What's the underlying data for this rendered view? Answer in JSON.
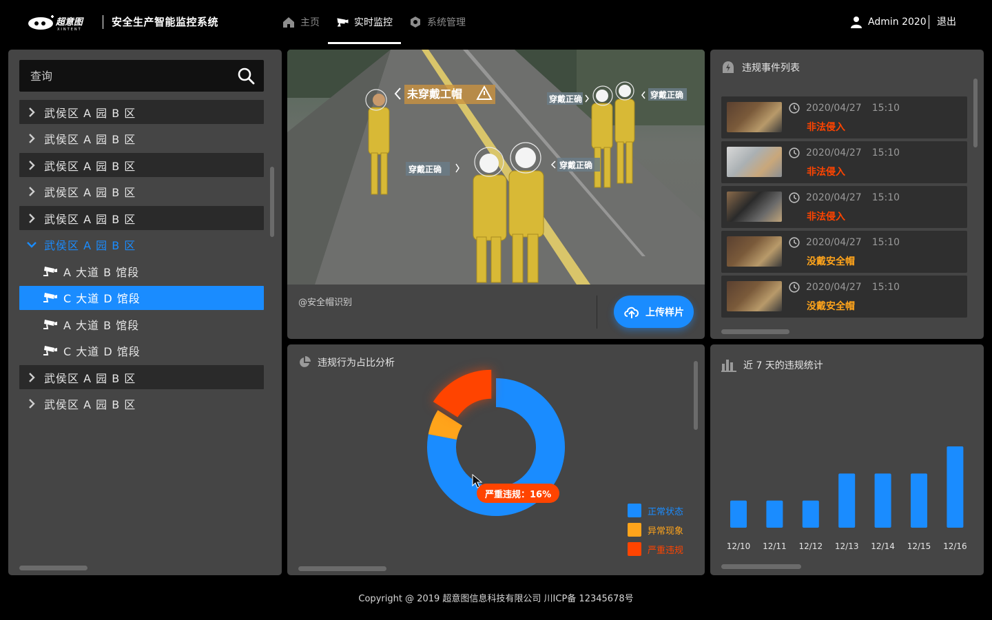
{
  "header": {
    "logo_text": "超意图",
    "logo_subtext": "XINTENT",
    "app_title": "安全生产智能监控系统",
    "nav": [
      {
        "label": "主页",
        "icon": "home-icon",
        "active": false
      },
      {
        "label": "实时监控",
        "icon": "camera-icon",
        "active": true
      },
      {
        "label": "系统管理",
        "icon": "settings-icon",
        "active": false
      }
    ],
    "user": "Admin 2020",
    "logout": "退出"
  },
  "tree": {
    "search_placeholder": "查询",
    "items": [
      {
        "label": "武侯区 A 园 B 区",
        "level": 0,
        "state": "collapsed"
      },
      {
        "label": "武侯区 A 园 B 区",
        "level": 0,
        "state": "collapsed"
      },
      {
        "label": "武侯区 A 园 B 区",
        "level": 0,
        "state": "collapsed"
      },
      {
        "label": "武侯区 A 园 B 区",
        "level": 0,
        "state": "collapsed"
      },
      {
        "label": "武侯区 A 园 B 区",
        "level": 0,
        "state": "collapsed"
      },
      {
        "label": "武侯区 A 园 B 区",
        "level": 0,
        "state": "expanded"
      },
      {
        "label": "A 大道 B 馆段",
        "level": 1,
        "state": "leaf"
      },
      {
        "label": "C 大道 D 馆段",
        "level": 1,
        "state": "selected"
      },
      {
        "label": "A 大道 B 馆段",
        "level": 1,
        "state": "leaf"
      },
      {
        "label": "C 大道 D 馆段",
        "level": 1,
        "state": "leaf"
      },
      {
        "label": "武侯区 A 园 B 区",
        "level": 0,
        "state": "collapsed"
      },
      {
        "label": "武侯区 A 园 B 区",
        "level": 0,
        "state": "collapsed"
      }
    ]
  },
  "video": {
    "annotations": [
      {
        "text": "未穿戴工帽",
        "kind": "alert"
      },
      {
        "text": "穿戴正确",
        "kind": "ok"
      },
      {
        "text": "穿戴正确",
        "kind": "ok"
      },
      {
        "text": "穿戴正确",
        "kind": "ok"
      },
      {
        "text": "穿戴正确",
        "kind": "ok"
      }
    ],
    "caption": "@安全帽识别",
    "upload_label": "上传样片"
  },
  "events": {
    "title": "违规事件列表",
    "items": [
      {
        "date": "2020/04/27",
        "time": "15:10",
        "label": "非法侵入",
        "color": "#ff4400"
      },
      {
        "date": "2020/04/27",
        "time": "15:10",
        "label": "非法侵入",
        "color": "#ff4400"
      },
      {
        "date": "2020/04/27",
        "time": "15:10",
        "label": "非法侵入",
        "color": "#ff4400"
      },
      {
        "date": "2020/04/27",
        "time": "15:10",
        "label": "没戴安全帽",
        "color": "#ffa41b"
      },
      {
        "date": "2020/04/27",
        "time": "15:10",
        "label": "没戴安全帽",
        "color": "#ffa41b"
      }
    ]
  },
  "pie": {
    "title": "违规行为占比分析",
    "tooltip": "严重违规：16%",
    "chart_data": {
      "type": "pie",
      "labels": [
        "正常状态",
        "异常现象",
        "严重违规"
      ],
      "values": [
        78,
        6,
        16
      ],
      "colors": [
        "#1a8cff",
        "#ffa41b",
        "#ff4400"
      ],
      "highlighted": "严重违规",
      "legend": "bottom-right"
    }
  },
  "bars": {
    "title": "近 7 天的违规统计",
    "chart_data": {
      "type": "bar",
      "categories": [
        "12/10",
        "12/11",
        "12/12",
        "12/13",
        "12/14",
        "12/15",
        "12/16"
      ],
      "values": [
        2,
        2,
        2,
        4,
        4,
        4,
        6
      ],
      "ylim": [
        0,
        6
      ],
      "grid": false,
      "color": "#1a8cff"
    }
  },
  "footer": "Copyright @ 2019 超意图信息科技有限公司 川ICP备 12345678号"
}
